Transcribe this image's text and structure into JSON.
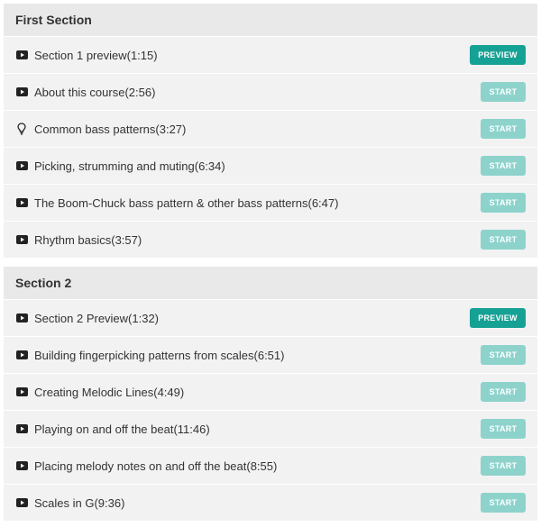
{
  "colors": {
    "preview_button": "#16a195",
    "start_button": "#8dd3cc",
    "header_bg": "#e9e9e9",
    "row_bg": "#f2f2f2"
  },
  "sections": [
    {
      "title": "First Section",
      "lessons": [
        {
          "title": "Section 1 preview(1:15)",
          "icon": "video-icon",
          "button": "PREVIEW"
        },
        {
          "title": "About this course(2:56)",
          "icon": "video-icon",
          "button": "START"
        },
        {
          "title": "Common bass patterns(3:27)",
          "icon": "lightbulb-icon",
          "button": "START"
        },
        {
          "title": "Picking, strumming and muting(6:34)",
          "icon": "video-icon",
          "button": "START"
        },
        {
          "title": "The Boom-Chuck bass pattern & other bass patterns(6:47)",
          "icon": "video-icon",
          "button": "START"
        },
        {
          "title": "Rhythm basics(3:57)",
          "icon": "video-icon",
          "button": "START"
        }
      ]
    },
    {
      "title": "Section 2",
      "lessons": [
        {
          "title": "Section 2 Preview(1:32)",
          "icon": "video-icon",
          "button": "PREVIEW"
        },
        {
          "title": "Building fingerpicking patterns from scales(6:51)",
          "icon": "video-icon",
          "button": "START"
        },
        {
          "title": "Creating Melodic Lines(4:49)",
          "icon": "video-icon",
          "button": "START"
        },
        {
          "title": "Playing on and off the beat(11:46)",
          "icon": "video-icon",
          "button": "START"
        },
        {
          "title": "Placing melody notes on and off the beat(8:55)",
          "icon": "video-icon",
          "button": "START"
        },
        {
          "title": "Scales in G(9:36)",
          "icon": "video-icon",
          "button": "START"
        }
      ]
    }
  ]
}
